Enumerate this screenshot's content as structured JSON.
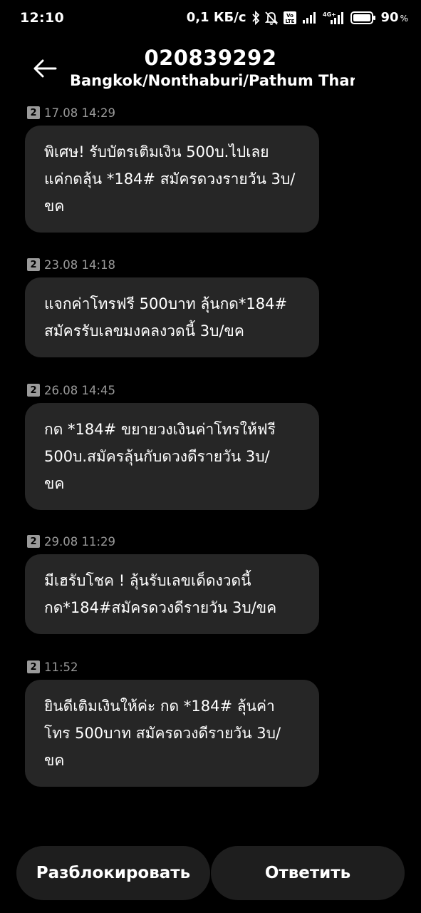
{
  "status_bar": {
    "time": "12:10",
    "network_speed": "0,1 КБ/с",
    "battery_percent": "90",
    "battery_unit": "%",
    "icons": [
      "bluetooth-icon",
      "bell-off-icon",
      "volte-icon",
      "signal-icon",
      "4g-icon",
      "battery-icon"
    ]
  },
  "header": {
    "title": "020839292",
    "subtitle": "Bangkok/Nonthaburi/Pathum Thani/…",
    "back_icon": "arrow-left-icon"
  },
  "messages": [
    {
      "sim": "2",
      "time": "17.08 14:29",
      "lines": [
        "พิเศษ! รับบัตรเติมเงิน 500บ.ไปเลย",
        "แค่กดลุ้น *184# สมัครดวงรายวัน 3บ/",
        "ขค"
      ]
    },
    {
      "sim": "2",
      "time": "23.08 14:18",
      "lines": [
        "แจกค่าโทรฟรี 500บาท ลุ้นกด*184#",
        "สมัครรับเลขมงคลงวดนี้ 3บ/ขค"
      ]
    },
    {
      "sim": "2",
      "time": "26.08 14:45",
      "lines": [
        "กด *184# ขยายวงเงินค่าโทรให้ฟรี",
        "500บ.สมัครลุ้นกับดวงดีรายวัน 3บ/",
        "ขค"
      ]
    },
    {
      "sim": "2",
      "time": "29.08 11:29",
      "lines": [
        "มีเฮรับโชค ! ลุ้นรับเลขเด็ดงวดนี้",
        "กด*184#สมัครดวงดีรายวัน 3บ/ขค"
      ]
    },
    {
      "sim": "2",
      "time": "11:52",
      "lines": [
        "ยินดีเติมเงินให้ค่ะ กด *184# ลุ้นค่า",
        "โทร 500บาท สมัครดวงดีรายวัน 3บ/",
        "ขค"
      ]
    }
  ],
  "actions": {
    "unblock_label": "Разблокировать",
    "reply_label": "Ответить"
  },
  "colors": {
    "background": "#000000",
    "bubble": "#262626",
    "button": "#1e1e1e",
    "meta_text": "#9a9a9a"
  }
}
